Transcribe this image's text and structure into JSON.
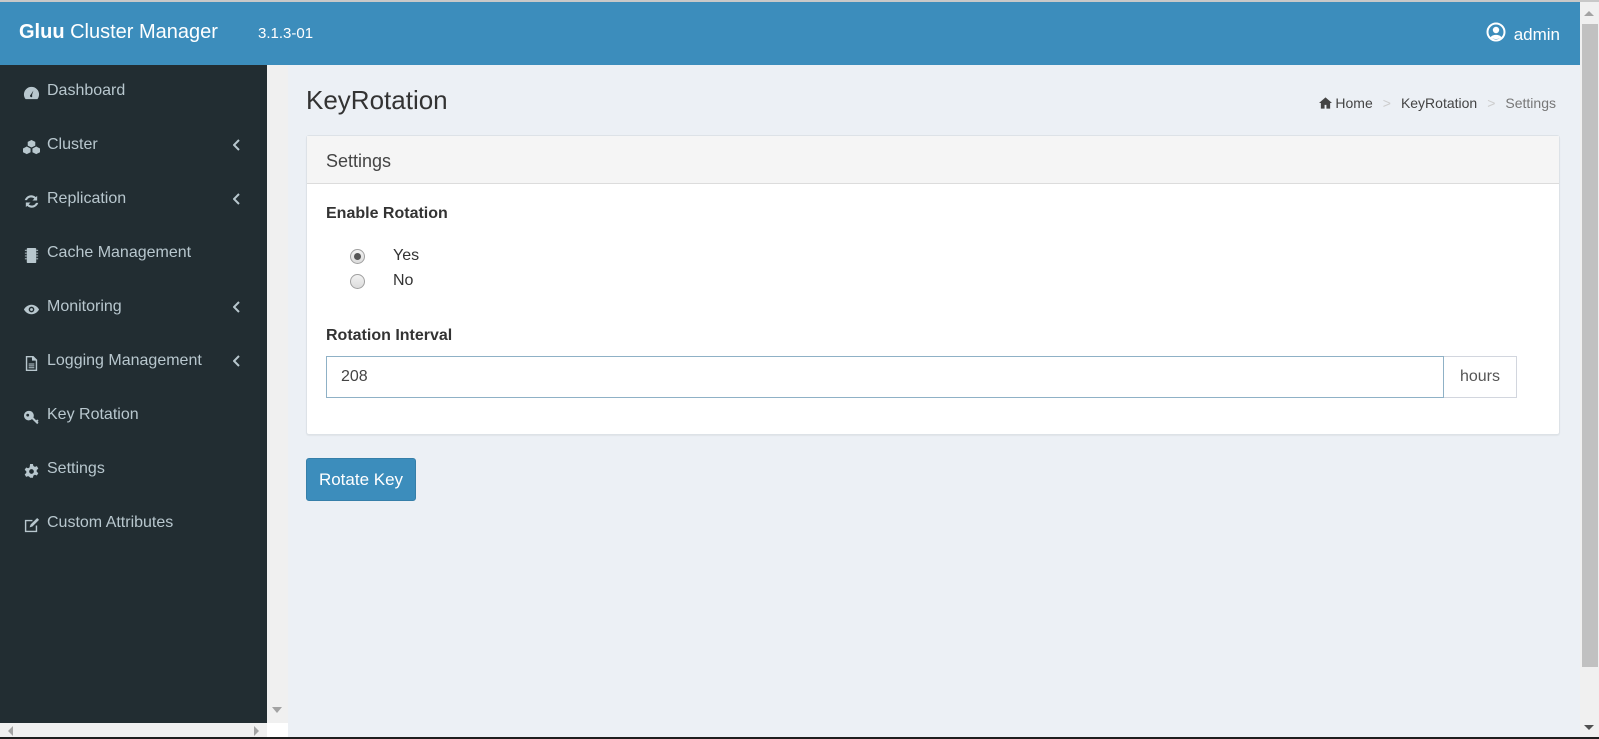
{
  "header": {
    "brand_bold": "Gluu",
    "brand_rest": " Cluster Manager",
    "version": "3.1.3-01",
    "user": "admin",
    "user_icon": "user-circle-icon",
    "color": "#3c8dbc"
  },
  "sidebar": {
    "color": "#222d32",
    "items": [
      {
        "label": "Dashboard",
        "icon": "dashboard-icon",
        "has_submenu": false
      },
      {
        "label": "Cluster",
        "icon": "cubes-icon",
        "has_submenu": true
      },
      {
        "label": "Replication",
        "icon": "refresh-icon",
        "has_submenu": true
      },
      {
        "label": "Cache Management",
        "icon": "chip-icon",
        "has_submenu": false
      },
      {
        "label": "Monitoring",
        "icon": "eye-icon",
        "has_submenu": true
      },
      {
        "label": "Logging Management",
        "icon": "file-text-icon",
        "has_submenu": true
      },
      {
        "label": "Key Rotation",
        "icon": "key-icon",
        "has_submenu": false
      },
      {
        "label": "Settings",
        "icon": "gear-icon",
        "has_submenu": false
      },
      {
        "label": "Custom Attributes",
        "icon": "edit-icon",
        "has_submenu": false
      }
    ]
  },
  "main": {
    "title": "KeyRotation",
    "breadcrumb": [
      {
        "label": "Home",
        "icon": "home-icon"
      },
      {
        "label": "KeyRotation"
      },
      {
        "label": "Settings",
        "active": true
      }
    ],
    "breadcrumb_sep": ">",
    "box": {
      "title": "Settings",
      "enable_rotation": {
        "label": "Enable Rotation",
        "options": [
          {
            "label": "Yes",
            "checked": true
          },
          {
            "label": "No",
            "checked": false
          }
        ]
      },
      "rotation_interval": {
        "label": "Rotation Interval",
        "value": "208",
        "unit": "hours"
      }
    },
    "rotate_button": "Rotate Key",
    "button_color": "#3c8dbc"
  }
}
